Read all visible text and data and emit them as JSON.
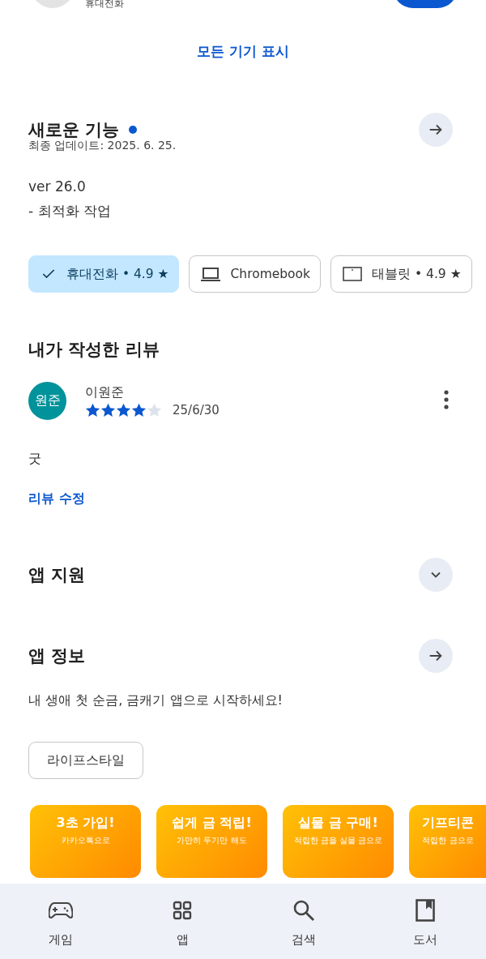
{
  "device_header": {
    "label": "휴대전화"
  },
  "show_all_devices": "모든 기기 표시",
  "whats_new": {
    "title": "새로운 기능",
    "new_dot": true,
    "updated": "최종 업데이트: 2025. 6. 25.",
    "lines": [
      "ver 26.0",
      "- 최적화 작업"
    ]
  },
  "device_chips": [
    {
      "kind": "phone",
      "label": "휴대전화 • 4.9 ★",
      "selected": true
    },
    {
      "kind": "laptop",
      "label": "Chromebook",
      "selected": false
    },
    {
      "kind": "tablet",
      "label": "태블릿 • 4.9 ★",
      "selected": false
    }
  ],
  "my_review": {
    "title": "내가 작성한 리뷰",
    "avatar": "원준",
    "name": "이원준",
    "stars": 4,
    "date": "25/6/30",
    "text": "굿",
    "edit_link": "리뷰 수정"
  },
  "app_support": {
    "title": "앱 지원",
    "expanded": false
  },
  "app_info": {
    "title": "앱 정보",
    "description": "내 생애 첫 순금, 금캐기 앱으로 시작하세요!",
    "category": "라이프스타일"
  },
  "screenshots": [
    {
      "title": "3초 가입!",
      "subtitle": "카카오톡으로"
    },
    {
      "title": "쉽게 금 적립!",
      "subtitle": "가만히 두기만 해도"
    },
    {
      "title": "실물 금 구매!",
      "subtitle": "적립한 금을 실물 금으로"
    },
    {
      "title": "기프티콘",
      "subtitle": "적립한 금으로"
    }
  ],
  "bottom_nav": [
    {
      "kind": "games",
      "label": "게임",
      "selected": false
    },
    {
      "kind": "apps",
      "label": "앱",
      "selected": false
    },
    {
      "kind": "search",
      "label": "검색",
      "selected": false
    },
    {
      "kind": "books",
      "label": "도서",
      "selected": false
    }
  ]
}
